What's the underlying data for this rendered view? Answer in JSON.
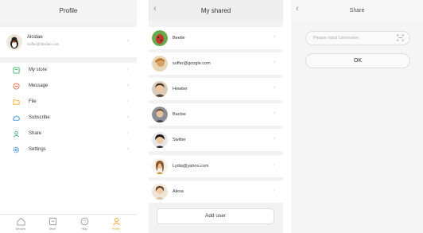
{
  "profile_screen": {
    "title": "Profile",
    "user": {
      "name": "Alcidae",
      "email": "Suffer@alcidae.com"
    },
    "menu": [
      {
        "label": "My store",
        "icon": "store-icon"
      },
      {
        "label": "Message",
        "icon": "message-icon"
      },
      {
        "label": "File",
        "icon": "folder-icon"
      },
      {
        "label": "Subscribe",
        "icon": "cloud-icon"
      },
      {
        "label": "Share",
        "icon": "share-user-icon"
      },
      {
        "label": "Settings",
        "icon": "gear-icon"
      }
    ],
    "tabs": [
      {
        "label": "Devices",
        "icon": "home-icon",
        "active": false
      },
      {
        "label": "Store",
        "icon": "store-icon",
        "active": false
      },
      {
        "label": "Help",
        "icon": "help-icon",
        "active": false
      },
      {
        "label": "Profile",
        "icon": "person-icon",
        "active": true
      }
    ],
    "accent_color": "#f5a623",
    "icon_colors": [
      "#3cb371",
      "#ff6a3d",
      "#f5a623",
      "#3a8ee6",
      "#3cb371",
      "#3a8ee6"
    ]
  },
  "shared_screen": {
    "title": "My shared",
    "contacts": [
      {
        "name": "Beetle"
      },
      {
        "name": "suffer@google.com"
      },
      {
        "name": "Hewiter"
      },
      {
        "name": "Bacbie"
      },
      {
        "name": "Switter"
      },
      {
        "name": "Lydia@yahoo.com"
      },
      {
        "name": "Alesa"
      }
    ],
    "add_button": "Add user"
  },
  "share_screen": {
    "title": "Share",
    "input_placeholder": "Please input Username",
    "ok_button": "OK"
  }
}
